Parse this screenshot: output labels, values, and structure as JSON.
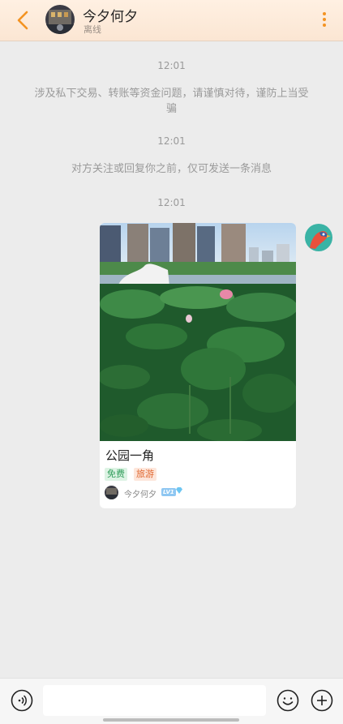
{
  "header": {
    "name": "今夕何夕",
    "status": "离线",
    "back_icon": "chevron-left-icon",
    "more_icon": "more-vertical-icon",
    "accent": "#f39322"
  },
  "messages": {
    "time_1": "12:01",
    "warning": "涉及私下交易、转账等资金问题，请谨慎对待，谨防上当受骗",
    "time_2": "12:01",
    "notice": "对方关注或回复你之前，仅可发送一条消息",
    "time_3": "12:01"
  },
  "card": {
    "title": "公园一角",
    "tags": [
      "免费",
      "旅游"
    ],
    "author": "今夕何夕",
    "level_badge": "LV1",
    "image": "lotus-pond-photo"
  },
  "input_bar": {
    "voice_icon": "voice-icon",
    "emoji_icon": "emoji-icon",
    "plus_icon": "plus-icon",
    "placeholder": ""
  }
}
